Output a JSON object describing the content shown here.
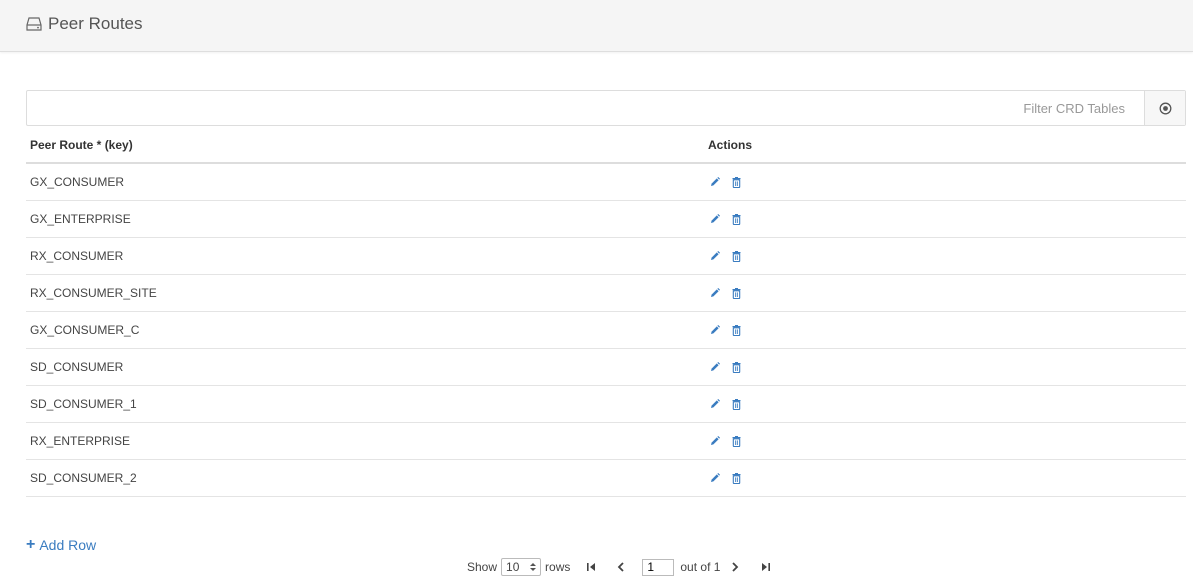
{
  "header": {
    "title": "Peer Routes",
    "icon": "hdd-icon"
  },
  "filter": {
    "placeholder": "Filter CRD Tables",
    "clear_icon": "clear-circle-icon"
  },
  "table": {
    "columns": [
      "Peer Route * (key)",
      "Actions"
    ],
    "rows": [
      "GX_CONSUMER",
      "GX_ENTERPRISE",
      "RX_CONSUMER",
      "RX_CONSUMER_SITE",
      "GX_CONSUMER_C",
      "SD_CONSUMER",
      "SD_CONSUMER_1",
      "RX_ENTERPRISE",
      "SD_CONSUMER_2"
    ],
    "action_icons": [
      "edit-icon",
      "delete-icon"
    ]
  },
  "add_row": {
    "label": "Add Row",
    "plus": "+"
  },
  "pagination": {
    "show_label": "Show",
    "rows_value": "10",
    "rows_label": "rows",
    "current_page": "1",
    "out_of_label": "out of 1"
  },
  "colors": {
    "accent": "#3a7cc0",
    "header_bg": "#f5f5f5"
  }
}
